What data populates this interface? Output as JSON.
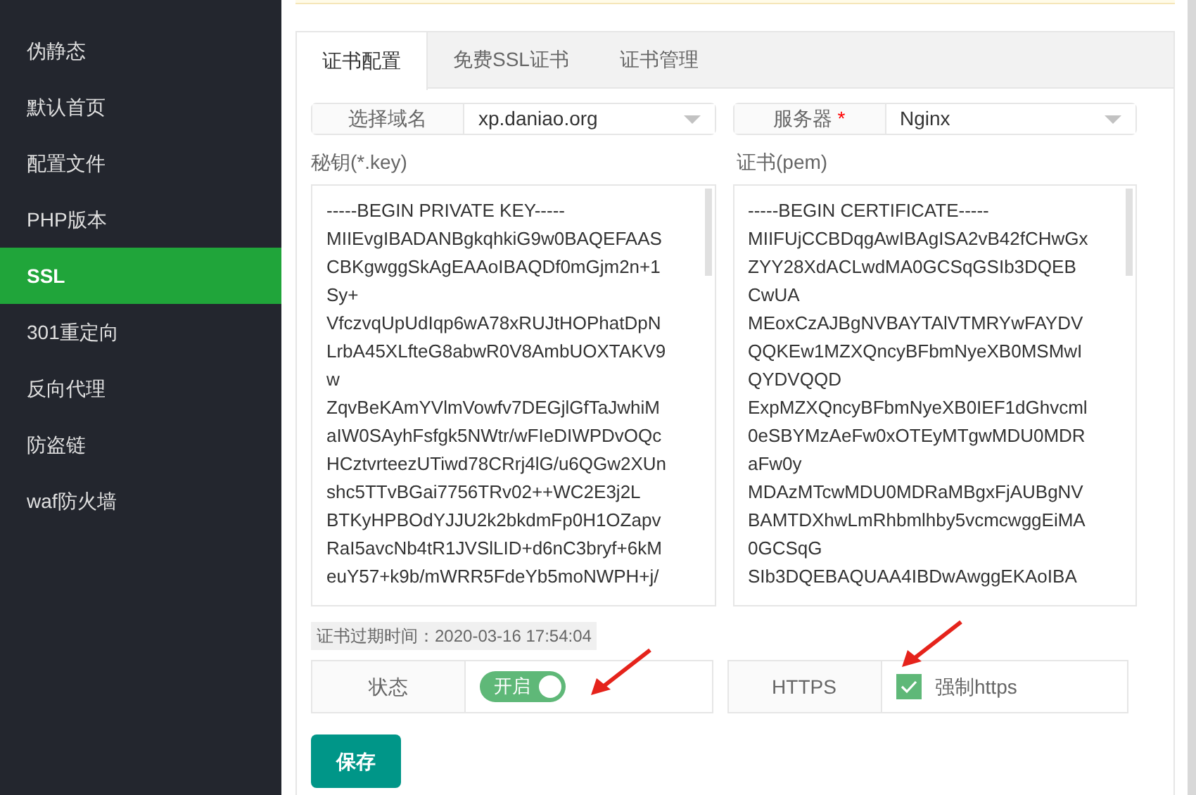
{
  "sidebar": {
    "items": [
      {
        "label": "伪静态",
        "selected": false
      },
      {
        "label": "默认首页",
        "selected": false
      },
      {
        "label": "配置文件",
        "selected": false
      },
      {
        "label": "PHP版本",
        "selected": false
      },
      {
        "label": "SSL",
        "selected": true
      },
      {
        "label": "301重定向",
        "selected": false
      },
      {
        "label": "反向代理",
        "selected": false
      },
      {
        "label": "防盗链",
        "selected": false
      },
      {
        "label": "waf防火墙",
        "selected": false
      }
    ]
  },
  "tabs": [
    {
      "label": "证书配置",
      "selected": true
    },
    {
      "label": "免费SSL证书",
      "selected": false
    },
    {
      "label": "证书管理",
      "selected": false
    }
  ],
  "domain_select": {
    "label": "选择域名",
    "value": "xp.daniao.org"
  },
  "server_select": {
    "label": "服务器",
    "required_mark": "*",
    "value": "Nginx"
  },
  "key_field": {
    "label": "秘钥(*.key)",
    "lines": [
      "-----BEGIN PRIVATE KEY-----",
      "MIIEvgIBADANBgkqhkiG9w0BAQEFAAS",
      "CBKgwggSkAgEAAoIBAQDf0mGjm2n+1",
      "Sy+",
      "VfczvqUpUdIqp6wA78xRUJtHOPhatDpN",
      "LrbA45XLfteG8abwR0V8AmbUOXTAKV9",
      "w",
      "ZqvBeKAmYVlmVowfv7DEGjlGfTaJwhiM",
      "aIW0SAyhFsfgk5NWtr/wFIeDIWPDvOQc",
      "HCztvrteezUTiwd78CRrj4lG/u6QGw2XUn",
      "shc5TTvBGai7756TRv02++WC2E3j2L",
      "BTKyHPBOdYJJU2k2bkdmFp0H1OZapv",
      "RaI5avcNb4tR1JVSlLID+d6nC3bryf+6kM",
      "euY57+k9b/mWRR5FdeYb5moNWPH+j/"
    ]
  },
  "cert_field": {
    "label": "证书(pem)",
    "lines": [
      "-----BEGIN CERTIFICATE-----",
      "MIIFUjCCBDqgAwIBAgISA2vB42fCHwGx",
      "ZYY28XdACLwdMA0GCSqGSIb3DQEB",
      "CwUA",
      "MEoxCzAJBgNVBAYTAlVTMRYwFAYDV",
      "QQKEw1MZXQncyBFbmNyeXB0MSMwI",
      "QYDVQQD",
      "ExpMZXQncyBFbmNyeXB0IEF1dGhvcml",
      "0eSBYMzAeFw0xOTEyMTgwMDU0MDR",
      "aFw0y",
      "MDAzMTcwMDU0MDRaMBgxFjAUBgNV",
      "BAMTDXhwLmRhbmlhby5vcmcwggEiMA",
      "0GCSqG",
      "SIb3DQEBAQUAA4IBDwAwggEKAoIBA"
    ]
  },
  "expiry": "证书过期时间：2020-03-16 17:54:04",
  "status_row": {
    "label": "状态",
    "toggle_label": "开启",
    "on": true
  },
  "https_row": {
    "label": "HTTPS",
    "checkbox_label": "强制https",
    "checked": true
  },
  "save_button": "保存"
}
